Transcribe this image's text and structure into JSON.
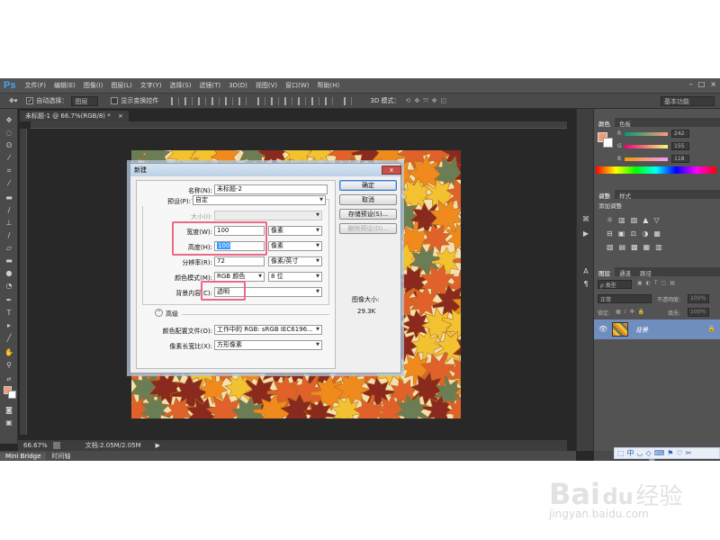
{
  "app": {
    "logo": "Ps",
    "menu": [
      "文件(F)",
      "编辑(E)",
      "图像(I)",
      "图层(L)",
      "文字(Y)",
      "选择(S)",
      "滤镜(T)",
      "3D(D)",
      "视图(V)",
      "窗口(W)",
      "帮助(H)"
    ],
    "window_controls": [
      "–",
      "□",
      "×"
    ]
  },
  "options_bar": {
    "auto_select_label": "自动选择：",
    "auto_select_value": "图层",
    "show_transform_label": "显示变换控件",
    "mode_3d_label": "3D 模式：",
    "workspace": "基本功能"
  },
  "document": {
    "tab_label": "未标题-1 @ 66.7%(RGB/8) *",
    "tab_close": "×"
  },
  "status": {
    "zoom": "66.67%",
    "doc_info": "文档:2.05M/2.05M"
  },
  "bottom_tabs": [
    "Mini Bridge",
    "时间轴"
  ],
  "panels": {
    "color": {
      "tabs": [
        "颜色",
        "色板"
      ],
      "channels": [
        {
          "label": "R",
          "value": "242"
        },
        {
          "label": "G",
          "value": "155"
        },
        {
          "label": "B",
          "value": "118"
        }
      ],
      "foreground": "#f29b76"
    },
    "adjustments": {
      "tabs": [
        "调整",
        "样式"
      ],
      "hint": "添加调整"
    },
    "layers": {
      "tabs": [
        "图层",
        "通道",
        "路径"
      ],
      "filter_type": "ρ 类型",
      "blend_mode": "正常",
      "opacity_label": "不透明度:",
      "opacity_value": "100%",
      "lock_label": "锁定:",
      "fill_label": "填充:",
      "fill_value": "100%",
      "layer_name": "背景"
    }
  },
  "dialog": {
    "title": "新建",
    "close": "x",
    "name_label": "名称(N):",
    "name_value": "未标题-2",
    "preset_label": "预设(P):",
    "preset_value": "自定",
    "size_label": "大小(I):",
    "size_value": "",
    "width_label": "宽度(W):",
    "width_value": "100",
    "width_unit": "像素",
    "height_label": "高度(H):",
    "height_value": "100",
    "height_unit": "像素",
    "resolution_label": "分辨率(R):",
    "resolution_value": "72",
    "resolution_unit": "像素/英寸",
    "color_mode_label": "颜色模式(M):",
    "color_mode_value": "RGB 颜色",
    "bit_depth": "8 位",
    "bg_label": "背景内容(C):",
    "bg_value": "透明",
    "advanced_label": "高级",
    "profile_label": "颜色配置文件(O):",
    "profile_value": "工作中的 RGB: sRGB IEC6196...",
    "pixel_aspect_label": "像素长宽比(X):",
    "pixel_aspect_value": "方形像素",
    "ok": "确定",
    "cancel": "取消",
    "save_preset": "存储预设(S)...",
    "delete_preset": "删除预设(D)...",
    "image_size_label": "图像大小:",
    "image_size_value": "29.3K"
  },
  "watermark": {
    "brand": "Bai",
    "paw": "du",
    "product": "经验",
    "url": "jingyan.baidu.com"
  },
  "colors": {
    "highlight": "#e86a86",
    "leaf_palette": [
      "#f08a1c",
      "#f2c230",
      "#6b7d55",
      "#8a2a1e",
      "#e0612a"
    ]
  }
}
